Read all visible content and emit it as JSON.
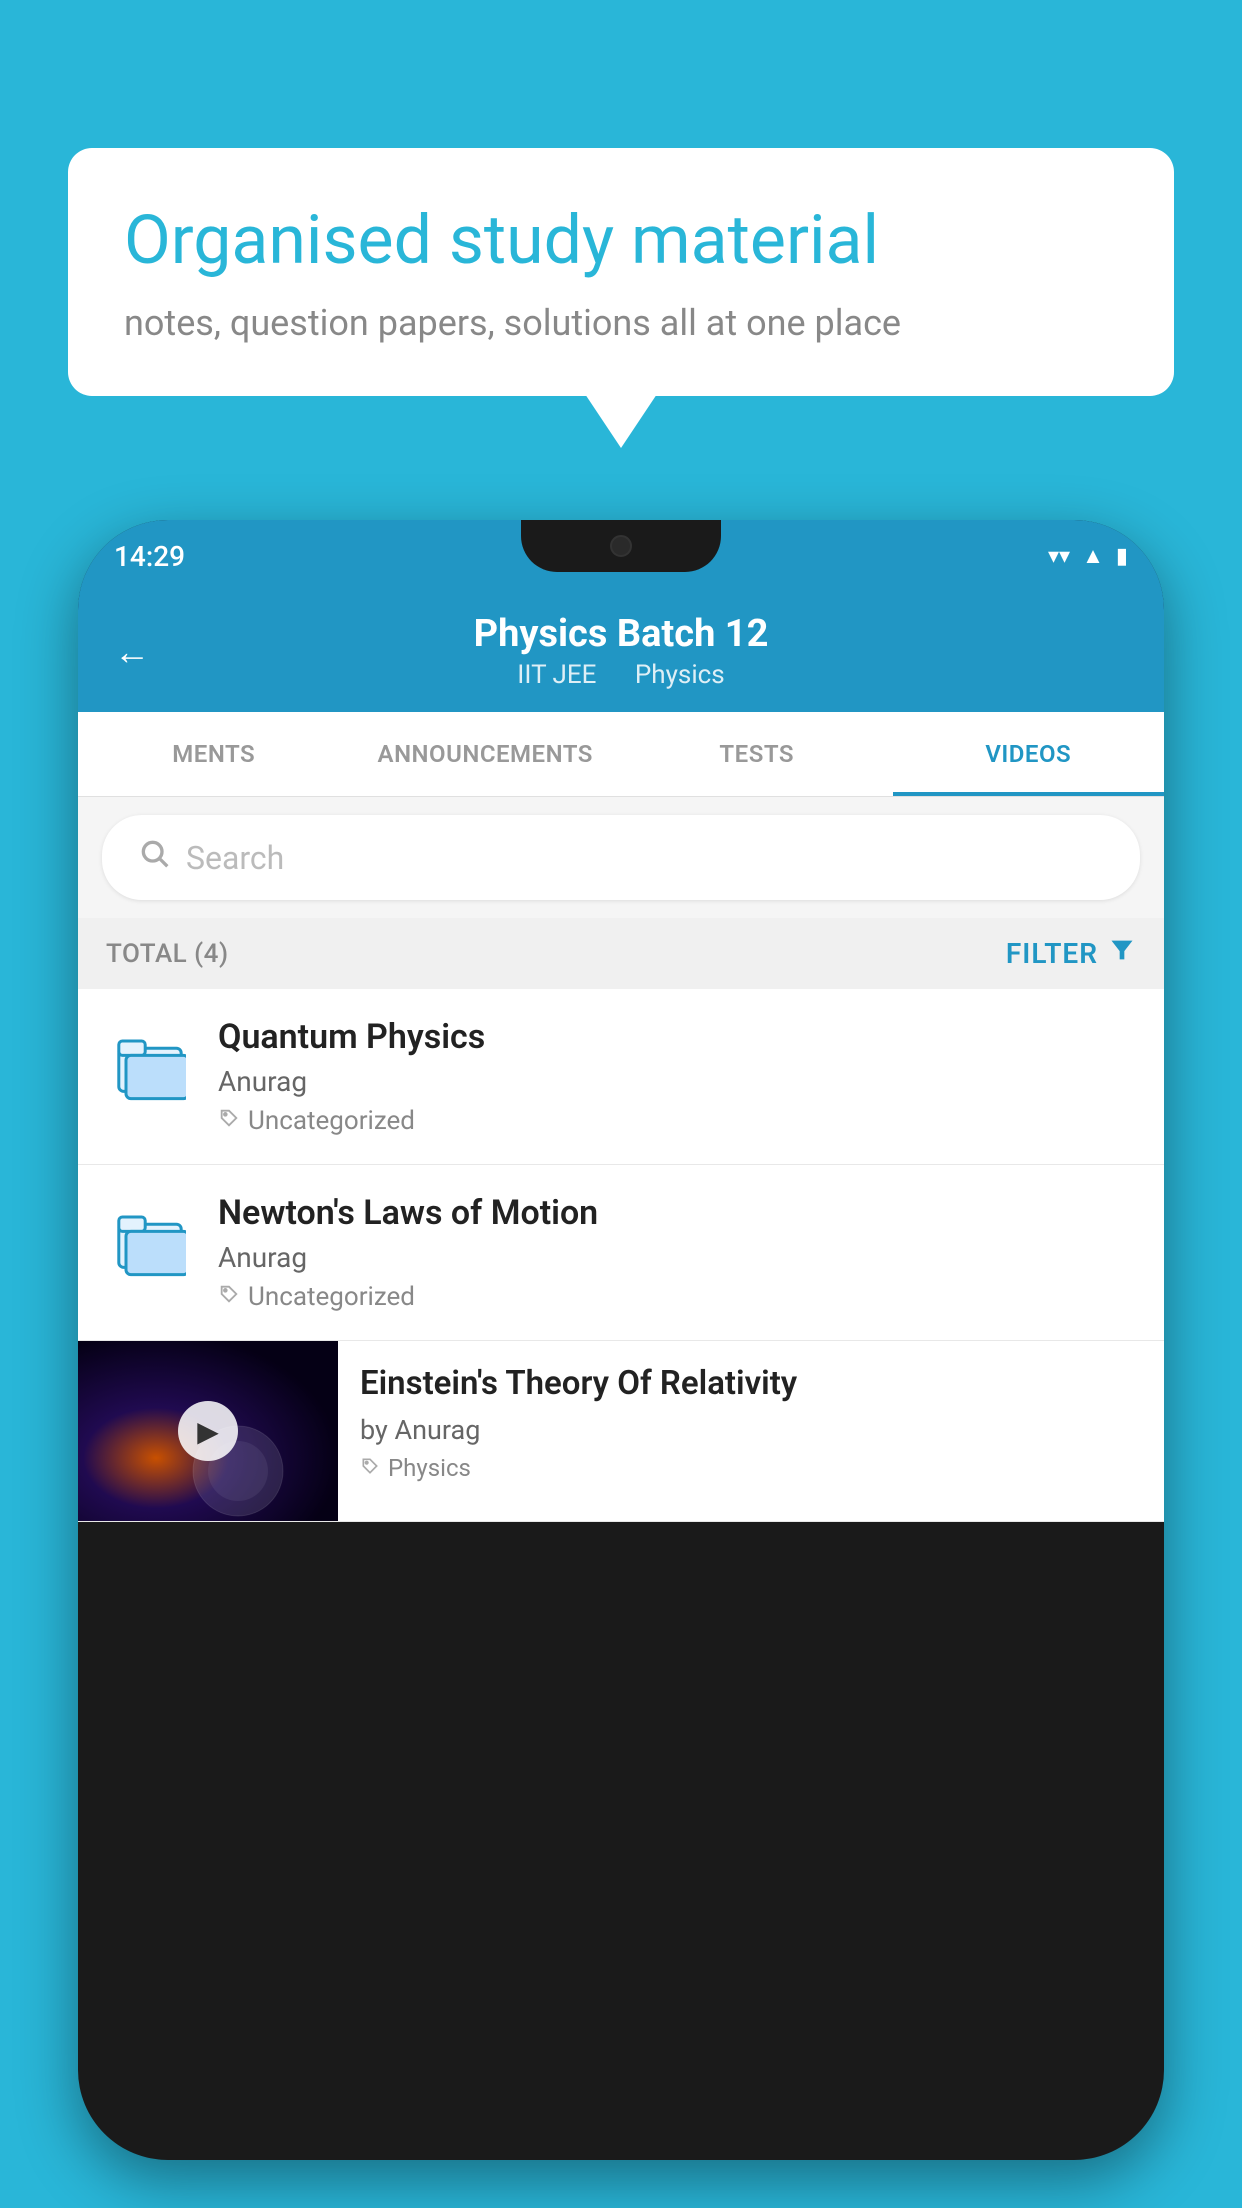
{
  "background": {
    "color": "#29b6d8"
  },
  "speech_bubble": {
    "title": "Organised study material",
    "subtitle": "notes, question papers, solutions all at one place"
  },
  "status_bar": {
    "time": "14:29",
    "icons": [
      "wifi",
      "signal",
      "battery"
    ]
  },
  "app_header": {
    "back_label": "←",
    "title": "Physics Batch 12",
    "subtitle_part1": "IIT JEE",
    "subtitle_part2": "Physics"
  },
  "tabs": [
    {
      "label": "MENTS",
      "active": false
    },
    {
      "label": "ANNOUNCEMENTS",
      "active": false
    },
    {
      "label": "TESTS",
      "active": false
    },
    {
      "label": "VIDEOS",
      "active": true
    }
  ],
  "search": {
    "placeholder": "Search"
  },
  "filter_bar": {
    "total_label": "TOTAL (4)",
    "filter_label": "FILTER"
  },
  "list_items": [
    {
      "title": "Quantum Physics",
      "author": "Anurag",
      "tag": "Uncategorized",
      "has_thumbnail": false
    },
    {
      "title": "Newton's Laws of Motion",
      "author": "Anurag",
      "tag": "Uncategorized",
      "has_thumbnail": false
    },
    {
      "title": "Einstein's Theory Of Relativity",
      "author": "by Anurag",
      "tag": "Physics",
      "has_thumbnail": true
    }
  ]
}
